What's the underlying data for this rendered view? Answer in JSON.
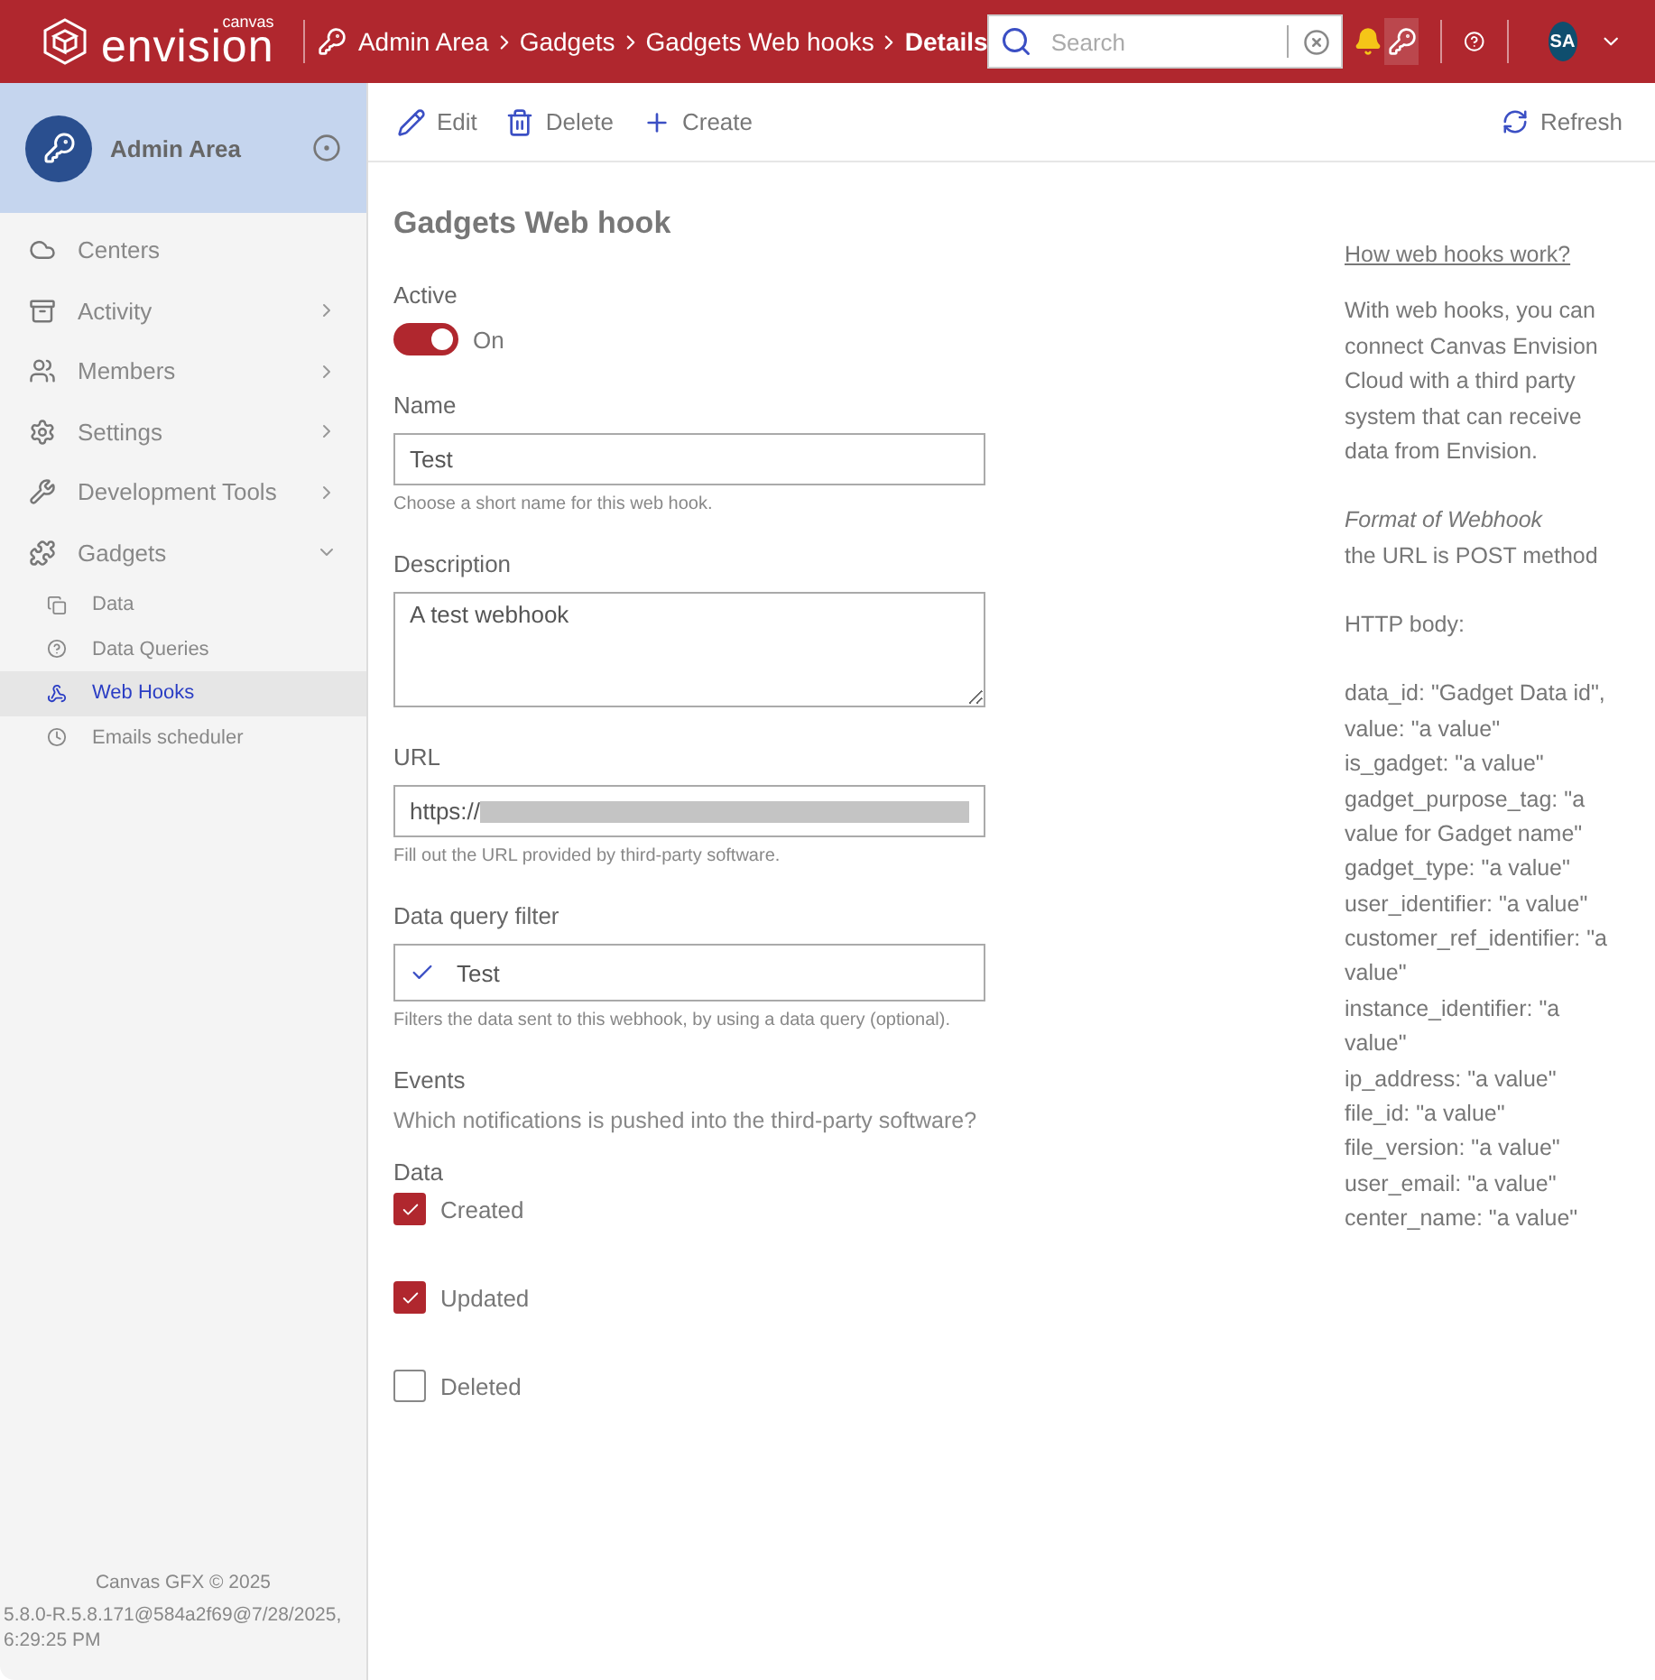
{
  "header": {
    "logo_small": "canvas",
    "logo": "envision",
    "breadcrumb": [
      {
        "label": "Admin Area",
        "current": false
      },
      {
        "label": "Gadgets",
        "current": false
      },
      {
        "label": "Gadgets Web hooks",
        "current": false
      },
      {
        "label": "Details",
        "current": true
      }
    ],
    "search": {
      "placeholder": "Search"
    },
    "avatar": "SA"
  },
  "sidebar": {
    "title": "Admin Area",
    "items": [
      {
        "label": "Centers"
      },
      {
        "label": "Activity",
        "expanded": false
      },
      {
        "label": "Members",
        "expanded": false
      },
      {
        "label": "Settings",
        "expanded": false
      },
      {
        "label": "Development Tools",
        "expanded": false
      },
      {
        "label": "Gadgets",
        "expanded": true,
        "children": [
          {
            "label": "Data",
            "selected": false
          },
          {
            "label": "Data Queries",
            "selected": false
          },
          {
            "label": "Web Hooks",
            "selected": true
          },
          {
            "label": "Emails scheduler",
            "selected": false
          }
        ]
      }
    ],
    "footer": "Canvas GFX © 2025",
    "version": "5.8.0-R.5.8.171@584a2f69@7/28/2025, 6:29:25 PM"
  },
  "toolbar": {
    "actions": [
      "Edit",
      "Delete",
      "Create"
    ],
    "refresh": "Refresh"
  },
  "form": {
    "title": "Gadgets Web hook",
    "active": {
      "label": "Active",
      "on": true,
      "text": "On"
    },
    "name": {
      "label": "Name",
      "value": "Test",
      "hint": "Choose a short name for this web hook."
    },
    "description": {
      "label": "Description",
      "value": "A test webhook"
    },
    "url": {
      "label": "URL",
      "value": "https://",
      "redacted": true,
      "hint": "Fill out the URL provided by third-party software."
    },
    "filter": {
      "label": "Data query filter",
      "value": "Test",
      "hint": "Filters the data sent to this webhook, by using a data query (optional)."
    },
    "events": {
      "label": "Events",
      "question": "Which notifications is pushed into the third-party software?",
      "group": "Data",
      "options": [
        {
          "label": "Created",
          "checked": true
        },
        {
          "label": "Updated",
          "checked": true
        },
        {
          "label": "Deleted",
          "checked": false
        }
      ]
    }
  },
  "help": {
    "link": "How web hooks work?",
    "intro": "With web hooks, you can connect Canvas Envision Cloud with a third party system that can receive data from Envision.",
    "format_title": "Format of Webhook",
    "format": "the URL is POST method",
    "body_title": "HTTP body:",
    "body": [
      "data_id: \"Gadget Data id\",",
      "value: \"a value\"",
      "is_gadget: \"a value\"",
      "gadget_purpose_tag: \"a value for Gadget name\"",
      "gadget_type: \"a value\"",
      "user_identifier: \"a value\"",
      "customer_ref_identifier: \"a value\"",
      "instance_identifier: \"a value\"",
      "ip_address: \"a value\"",
      "file_id: \"a value\"",
      "file_version: \"a value\"",
      "user_email: \"a value\"",
      "center_name: \"a value\""
    ]
  }
}
